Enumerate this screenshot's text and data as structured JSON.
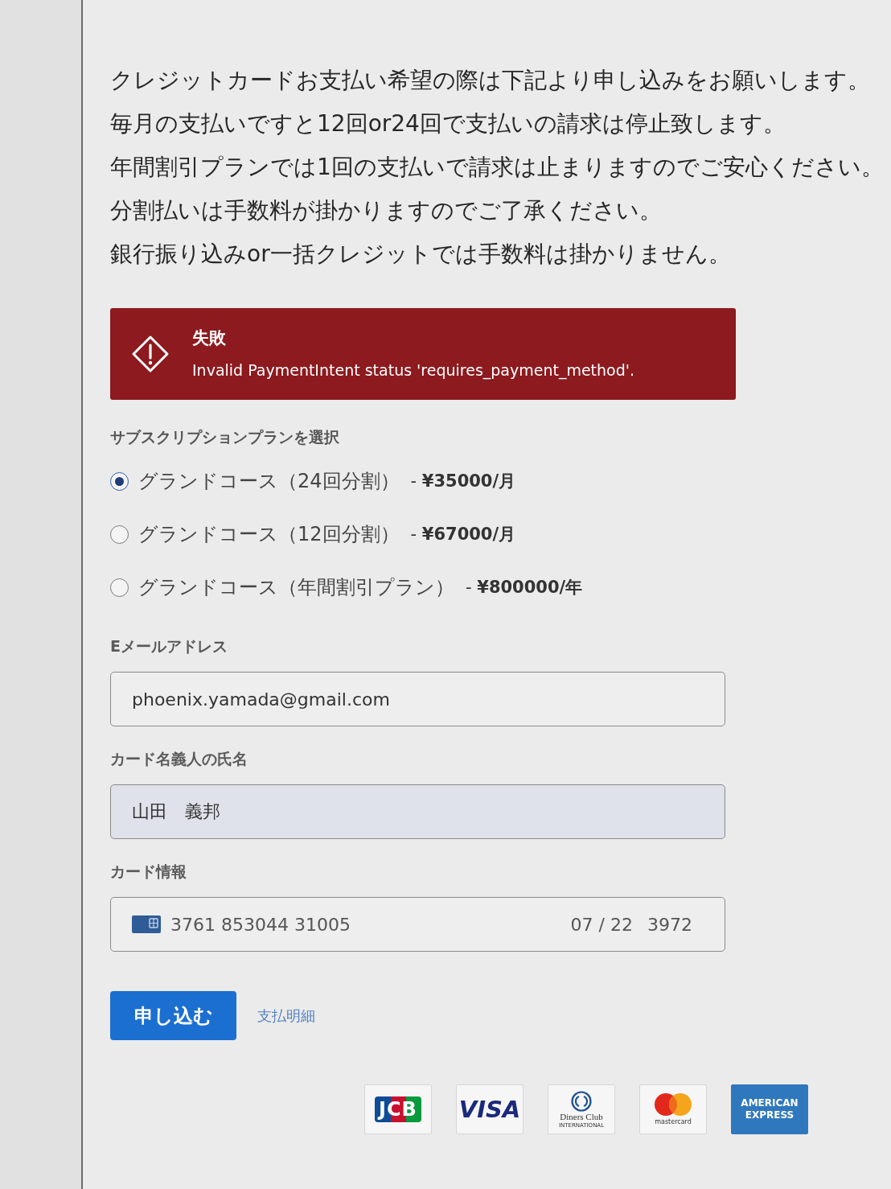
{
  "intro": {
    "lines": [
      "クレジットカードお支払い希望の際は下記より申し込みをお願いします。",
      "毎月の支払いですと12回or24回で支払いの請求は停止致します。",
      "年間割引プランでは1回の支払いで請求は止まりますのでご安心ください。",
      "分割払いは手数料が掛かりますのでご了承ください。",
      "銀行振り込みor一括クレジットでは手数料は掛かりません。"
    ]
  },
  "alert": {
    "kind": "error",
    "title": "失敗",
    "message": "Invalid PaymentIntent status 'requires_payment_method'."
  },
  "plan_select": {
    "label": "サブスクリプションプランを選択",
    "options": [
      {
        "name": "グランドコース（24回分割）",
        "price": "- **¥35000/月**",
        "selected": true
      },
      {
        "name": "グランドコース（12回分割）",
        "price": "- **¥67000/月**",
        "selected": false
      },
      {
        "name": "グランドコース（年間割引プラン）",
        "price": "- **¥800000/年**",
        "selected": false
      }
    ]
  },
  "fields": [
    {
      "kind": "email",
      "label": "Eメールアドレス",
      "value": "phoenix.yamada@gmail.com",
      "autofilled": false
    },
    {
      "kind": "name",
      "label": "カード名義人の氏名",
      "value": "山田　義邦",
      "autofilled": true
    },
    {
      "kind": "card",
      "label": "カード情報",
      "number": "3761 853044 31005",
      "expiry": "07 / 22",
      "cvc": "3972"
    }
  ],
  "actions": {
    "submit": "申し込む",
    "details_link": "支払明細"
  },
  "card_brands": [
    {
      "kind": "jcb",
      "label": "JCB"
    },
    {
      "kind": "visa",
      "label": "VISA"
    },
    {
      "kind": "diners",
      "label": "Diners Club",
      "sublabel": "INTERNATIONAL"
    },
    {
      "kind": "mastercard",
      "label": "mastercard"
    },
    {
      "kind": "amex",
      "label": "AMERICAN EXPRESS"
    }
  ]
}
